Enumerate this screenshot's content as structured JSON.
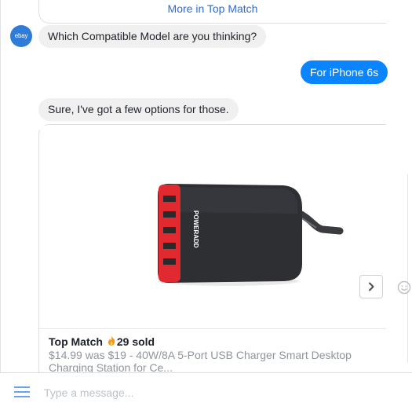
{
  "top_card": {
    "link_label": "More in Top Match"
  },
  "bot": {
    "avatar_text": "ebay"
  },
  "messages": {
    "q1": "Which Compatible Model are you thinking?",
    "a1": "For iPhone 6s",
    "q2": "Sure, I've got a few options for those."
  },
  "product": {
    "title": "Top Match",
    "sold": "29 sold",
    "description": "$14.99 was $19 - 40W/8A 5-Port USB Charger Smart Desktop Charging Station for Ce...",
    "brand_text": "POWERADD"
  },
  "composer": {
    "placeholder": "Type a message..."
  },
  "colors": {
    "accent": "#0a84ff",
    "link": "#2e6cd8",
    "charger_body": "#2d2f33",
    "ports": "#e02a2f"
  }
}
